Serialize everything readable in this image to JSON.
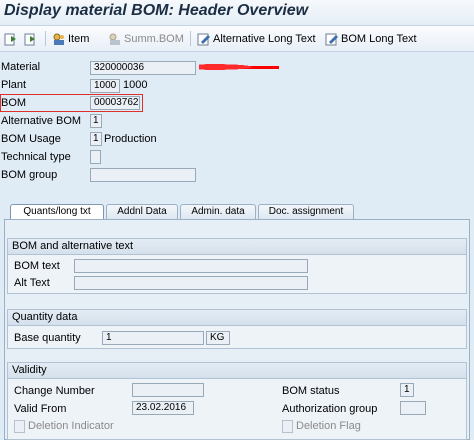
{
  "title": "Display material BOM: Header Overview",
  "toolbar": {
    "item_label": "Item",
    "summ_bom_label": "Summ.BOM",
    "alt_long_text_label": "Alternative Long Text",
    "bom_long_text_label": "BOM Long Text"
  },
  "header": {
    "material_label": "Material",
    "material_value": "320000036",
    "plant_label": "Plant",
    "plant_value": "1000",
    "plant_text": "1000",
    "bom_label": "BOM",
    "bom_value": "00003762",
    "alt_bom_label": "Alternative BOM",
    "alt_bom_value": "1",
    "bom_usage_label": "BOM Usage",
    "bom_usage_value": "1",
    "bom_usage_text": "Production",
    "technical_type_label": "Technical type",
    "technical_type_value": "",
    "bom_group_label": "BOM group",
    "bom_group_value": ""
  },
  "tabs": [
    {
      "label": "Quants/long txt",
      "active": true
    },
    {
      "label": "Addnl Data",
      "active": false
    },
    {
      "label": "Admin. data",
      "active": false
    },
    {
      "label": "Doc. assignment",
      "active": false
    }
  ],
  "groups": {
    "bom_text_group": {
      "title": "BOM and alternative text",
      "bom_text_label": "BOM text",
      "bom_text_value": "",
      "alt_text_label": "Alt Text",
      "alt_text_value": ""
    },
    "quantity_group": {
      "title": "Quantity data",
      "base_qty_label": "Base quantity",
      "base_qty_value": "1",
      "unit_value": "KG"
    },
    "validity_group": {
      "title": "Validity",
      "change_number_label": "Change Number",
      "change_number_value": "",
      "valid_from_label": "Valid From",
      "valid_from_value": "23.02.2016",
      "deletion_indicator_label": "Deletion Indicator",
      "bom_status_label": "BOM status",
      "bom_status_value": "1",
      "auth_group_label": "Authorization group",
      "auth_group_value": "",
      "deletion_flag_label": "Deletion Flag"
    }
  },
  "colors": {
    "highlight_border": "#e0302a",
    "redaction": "#ff0000"
  }
}
